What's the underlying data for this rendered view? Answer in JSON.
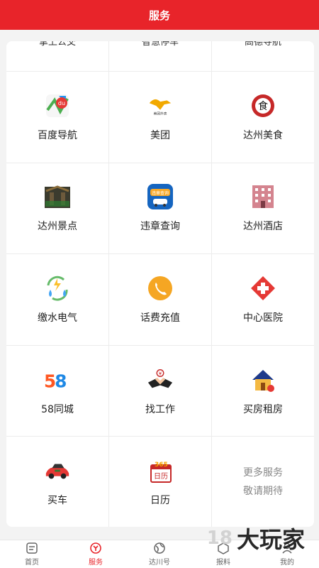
{
  "header": {
    "title": "服务"
  },
  "partial_row": [
    "掌上公交",
    "智慧停车",
    "高德导航"
  ],
  "grid": [
    [
      {
        "label": "百度导航",
        "icon": "baidu-map-icon"
      },
      {
        "label": "美团",
        "icon": "meituan-icon"
      },
      {
        "label": "达州美食",
        "icon": "food-icon"
      }
    ],
    [
      {
        "label": "达州景点",
        "icon": "scenic-icon"
      },
      {
        "label": "违章查询",
        "icon": "traffic-violation-icon"
      },
      {
        "label": "达州酒店",
        "icon": "hotel-icon"
      }
    ],
    [
      {
        "label": "缴水电气",
        "icon": "utilities-icon"
      },
      {
        "label": "话费充值",
        "icon": "phone-icon"
      },
      {
        "label": "中心医院",
        "icon": "hospital-icon"
      }
    ],
    [
      {
        "label": "58同城",
        "icon": "58-icon"
      },
      {
        "label": "找工作",
        "icon": "job-icon"
      },
      {
        "label": "买房租房",
        "icon": "house-icon"
      }
    ],
    [
      {
        "label": "买车",
        "icon": "car-icon"
      },
      {
        "label": "日历",
        "icon": "calendar-icon"
      },
      {
        "more1": "更多服务",
        "more2": "敬请期待"
      }
    ]
  ],
  "tabbar": [
    "首页",
    "服务",
    "达川号",
    "报料",
    "我的"
  ],
  "watermark": {
    "num": "18",
    "text": "大玩家"
  },
  "colors": {
    "brand": "#e8242a"
  }
}
